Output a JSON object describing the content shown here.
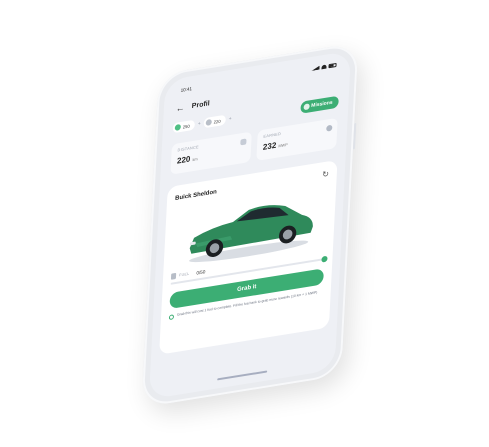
{
  "status": {
    "time": "10:41"
  },
  "header": {
    "back_icon": "arrow-left-icon",
    "title": "Profil"
  },
  "chips": [
    {
      "value": "250",
      "color": "#4fbf85"
    },
    {
      "value": "220",
      "color": "#b9bfc8"
    }
  ],
  "missions": {
    "label": "Missions"
  },
  "stats": {
    "distance": {
      "label": "DISTANCE",
      "value": "220",
      "unit": "km"
    },
    "earned": {
      "label": "EARNED",
      "value": "232",
      "unit": "MWP"
    }
  },
  "car": {
    "name": "Buick Sheldon",
    "color": "#2f8a5b"
  },
  "fuel": {
    "label": "FUEL",
    "value": "0/50",
    "level": 1.0
  },
  "grab_label": "Grab it",
  "note": "Grab this will cost 1 fuel to complete. Fill the fuel tank to grab more rewards (10 km = 1 MWP)",
  "accent": "#3cae74"
}
